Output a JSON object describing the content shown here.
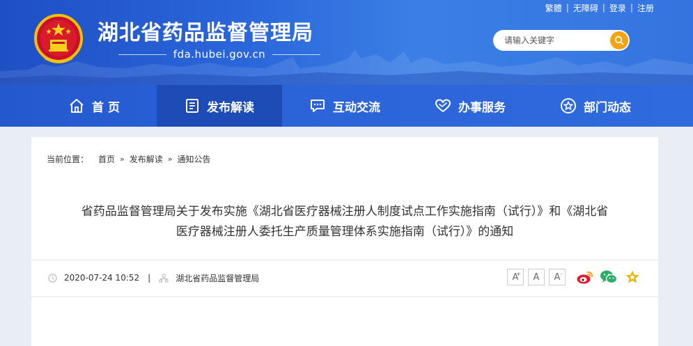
{
  "top_links": [
    "繁體",
    "无障碍",
    "登录",
    "注册"
  ],
  "header": {
    "title": "湖北省药品监督管理局",
    "domain": "fda.hubei.gov.cn"
  },
  "search": {
    "placeholder": "请输入关键字"
  },
  "nav": [
    {
      "label": "首 页",
      "icon": "home-icon"
    },
    {
      "label": "发布解读",
      "icon": "document-icon"
    },
    {
      "label": "互动交流",
      "icon": "chat-icon"
    },
    {
      "label": "办事服务",
      "icon": "heart-icon"
    },
    {
      "label": "部门动态",
      "icon": "star-circle-icon"
    }
  ],
  "nav_active_index": 1,
  "breadcrumb": {
    "label": "当前位置：",
    "items": [
      "首页",
      "发布解读",
      "通知公告"
    ]
  },
  "article": {
    "title_line1": "省药品监督管理局关于发布实施《湖北省医疗器械注册人制度试点工作实施指南（试行）》和《湖北省",
    "title_line2": "医疗器械注册人委托生产质量管理体系实施指南（试行）》的通知",
    "date": "2020-07-24 10:52",
    "separator": "|",
    "source": "湖北省药品监督管理局"
  },
  "font_size_buttons": [
    "A",
    "A",
    "A"
  ],
  "share_icons": [
    "weibo-icon",
    "wechat-icon",
    "favorite-star-icon"
  ],
  "colors": {
    "header_blue": "#2a66da",
    "nav_active": "#1d4cb6",
    "search_button": "#f5a30f",
    "favorite_star": "#f0b400",
    "weibo_red": "#e6162d",
    "wechat_green": "#2aae67"
  }
}
